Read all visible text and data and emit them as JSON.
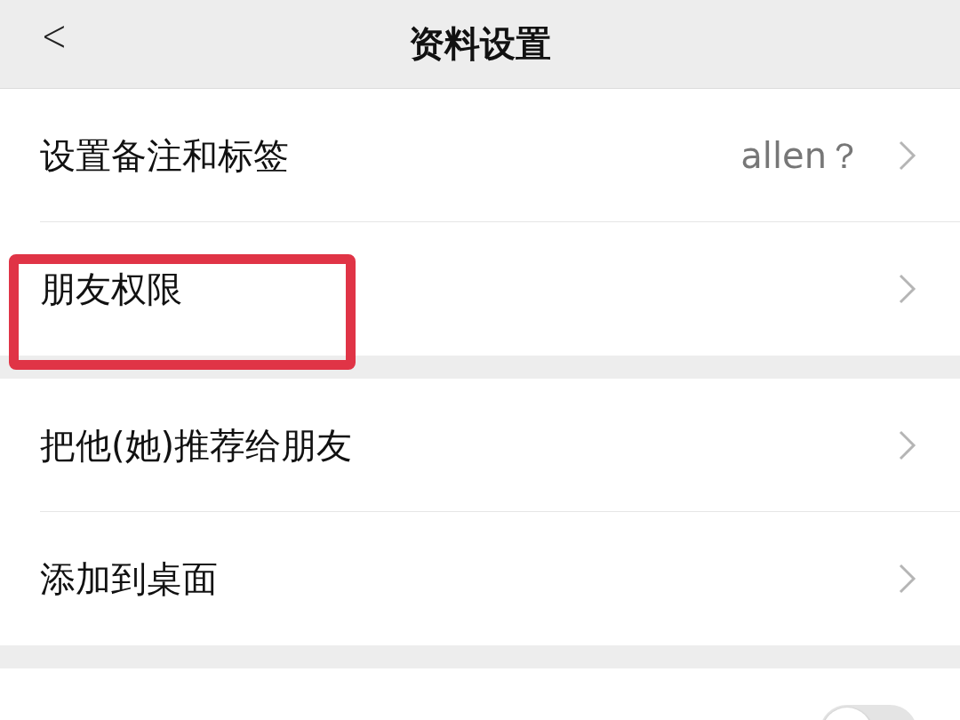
{
  "header": {
    "back": "<",
    "title": "资料设置"
  },
  "groups": [
    {
      "items": [
        {
          "kind": "link",
          "label": "设置备注和标签",
          "value": "allen？",
          "highlighted": false
        },
        {
          "kind": "link",
          "label": "朋友权限",
          "highlighted": true
        }
      ]
    },
    {
      "items": [
        {
          "kind": "link",
          "label": "把他(她)推荐给朋友",
          "highlighted": false
        },
        {
          "kind": "link",
          "label": "添加到桌面",
          "highlighted": false
        }
      ]
    },
    {
      "items": [
        {
          "kind": "toggle",
          "on": false
        }
      ]
    }
  ]
}
